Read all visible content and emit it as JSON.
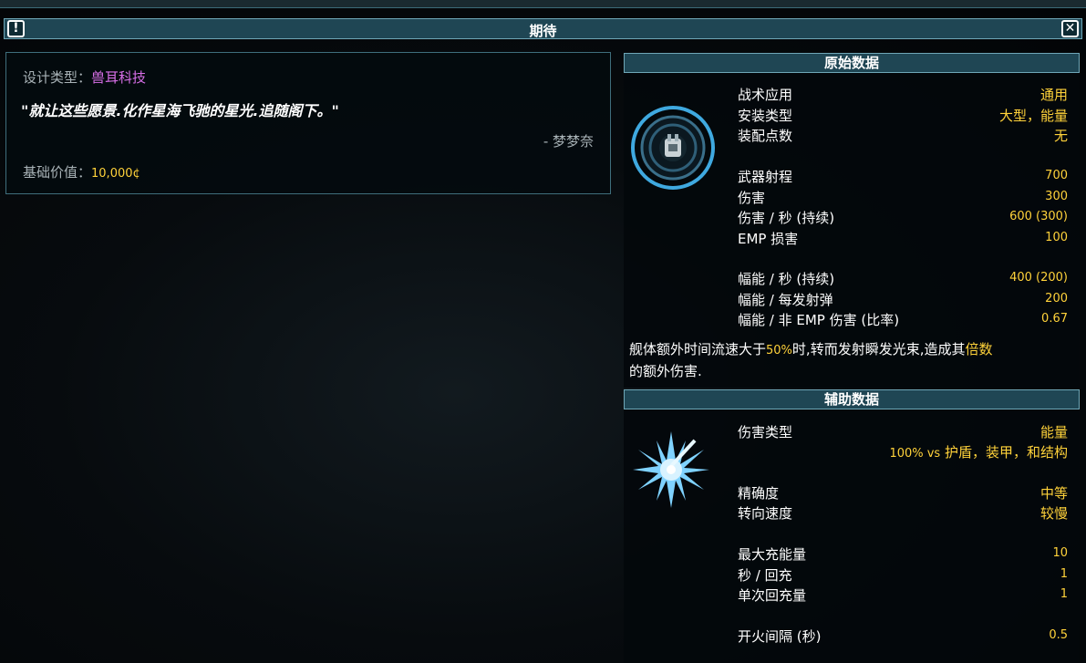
{
  "window": {
    "title": "期待",
    "info_icon": "exclamation-icon",
    "close_icon": "close-x-icon"
  },
  "lore": {
    "design_label": "设计类型：",
    "manufacturer": "兽耳科技",
    "quote": "\"就让这些愿景.化作星海飞驰的星光.追随阁下。\"",
    "author": "- 梦梦奈",
    "value_label": "基础价值：",
    "value": "10,000¢"
  },
  "primary": {
    "header": "原始数据",
    "rows": [
      {
        "label": "战术应用",
        "value": "通用"
      },
      {
        "label": "安装类型",
        "value": "大型，能量"
      },
      {
        "label": "装配点数",
        "value": "无"
      },
      {
        "label": "武器射程",
        "value": "700"
      },
      {
        "label": "伤害",
        "value": "300"
      },
      {
        "label": "伤害 / 秒 (持续)",
        "value": "600 (300)"
      },
      {
        "label": "EMP 损害",
        "value": "100"
      },
      {
        "label": "幅能 / 秒 (持续)",
        "value": "400 (200)"
      },
      {
        "label": "幅能 / 每发射弹",
        "value": "200"
      },
      {
        "label": "幅能 / 非 EMP 伤害 (比率)",
        "value": "0.67"
      }
    ],
    "desc_1": "舰体额外时间流速大于",
    "desc_pct": "50%",
    "desc_2": "时,转而发射瞬发光束,造成其",
    "desc_3": "倍数",
    "desc_4": "的额外伤害."
  },
  "ancillary": {
    "header": "辅助数据",
    "damage_type_label": "伤害类型",
    "damage_type_value": "能量",
    "damage_vs_pct": "100% vs",
    "damage_vs_text": "护盾，装甲，和结构",
    "rows": [
      {
        "label": "精确度",
        "value": "中等"
      },
      {
        "label": "转向速度",
        "value": "较慢"
      },
      {
        "label": "最大充能量",
        "value": "10"
      },
      {
        "label": "秒 / 回充",
        "value": "1"
      },
      {
        "label": "单次回充量",
        "value": "1"
      },
      {
        "label": "开火间隔 (秒)",
        "value": "0.5"
      }
    ]
  },
  "colors": {
    "accent": "#ffd23a",
    "manufacturer": "#d86fe8",
    "header_bg": "#1f4654",
    "border": "#6fa7b7"
  }
}
